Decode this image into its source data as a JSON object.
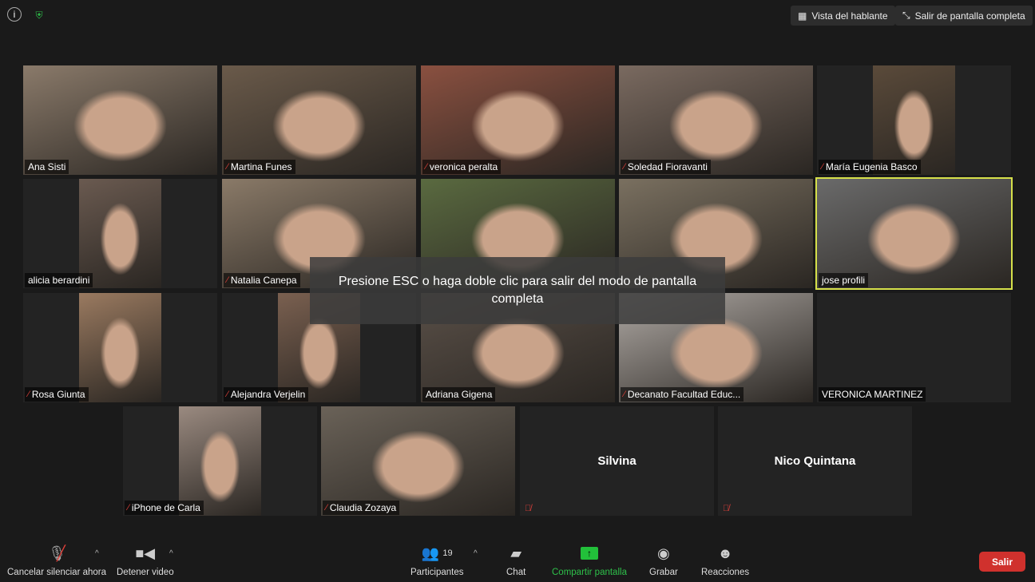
{
  "top": {
    "speaker_view": "Vista del hablante",
    "exit_fullscreen": "Salir de pantalla completa"
  },
  "toast": "Presione ESC o haga doble clic para salir del modo de pantalla completa",
  "participants": [
    {
      "name": "Ana Sisti",
      "muted": false,
      "video": true,
      "color": "#8a7a6a"
    },
    {
      "name": "Martina Funes",
      "muted": true,
      "video": true,
      "color": "#6a5a4a"
    },
    {
      "name": "veronica peralta",
      "muted": true,
      "video": true,
      "color": "#8a5040"
    },
    {
      "name": "Soledad Fioravanti",
      "muted": true,
      "video": true,
      "color": "#7a6a60"
    },
    {
      "name": "María Eugenia Basco",
      "muted": true,
      "video": true,
      "color": "#5a4a3a",
      "narrow": true
    },
    {
      "name": "alicia berardini",
      "muted": false,
      "video": true,
      "color": "#6a5a50",
      "narrow": true
    },
    {
      "name": "Natalia Canepa",
      "muted": true,
      "video": true,
      "color": "#8a7a68"
    },
    {
      "name": "",
      "muted": false,
      "video": true,
      "color": "#5a6a40"
    },
    {
      "name": "",
      "muted": false,
      "video": true,
      "color": "#7a7060"
    },
    {
      "name": "jose profili",
      "muted": false,
      "video": true,
      "color": "#6a6a6a",
      "active": true
    },
    {
      "name": "Rosa Giunta",
      "muted": true,
      "video": true,
      "color": "#9a7a60",
      "narrow": true
    },
    {
      "name": "Alejandra Verjelin",
      "muted": true,
      "video": true,
      "color": "#7a6050",
      "narrow": true
    },
    {
      "name": "Adriana Gigena",
      "muted": false,
      "video": true,
      "color": "#5a5048"
    },
    {
      "name": "Decanato Facultad Educ...",
      "muted": true,
      "video": true,
      "color": "#b0aaa5"
    },
    {
      "name": "VERONICA MARTINEZ",
      "muted": false,
      "video": false
    },
    {
      "name": "iPhone de Carla",
      "muted": true,
      "video": true,
      "color": "#9a8a80",
      "narrow": true
    },
    {
      "name": "Claudia Zozaya",
      "muted": true,
      "video": true,
      "color": "#6a6258"
    },
    {
      "name": "Silvina",
      "muted": true,
      "video": false,
      "centered": true
    },
    {
      "name": "Nico Quintana",
      "muted": true,
      "video": false,
      "centered": true
    }
  ],
  "toolbar": {
    "unmute": "Cancelar silenciar ahora",
    "video": "Detener video",
    "participants": "Participantes",
    "participant_count": "19",
    "chat": "Chat",
    "share": "Compartir pantalla",
    "record": "Grabar",
    "reactions": "Reacciones",
    "leave": "Salir",
    "share_color": "#22c03a",
    "leave_color": "#d0312d"
  }
}
